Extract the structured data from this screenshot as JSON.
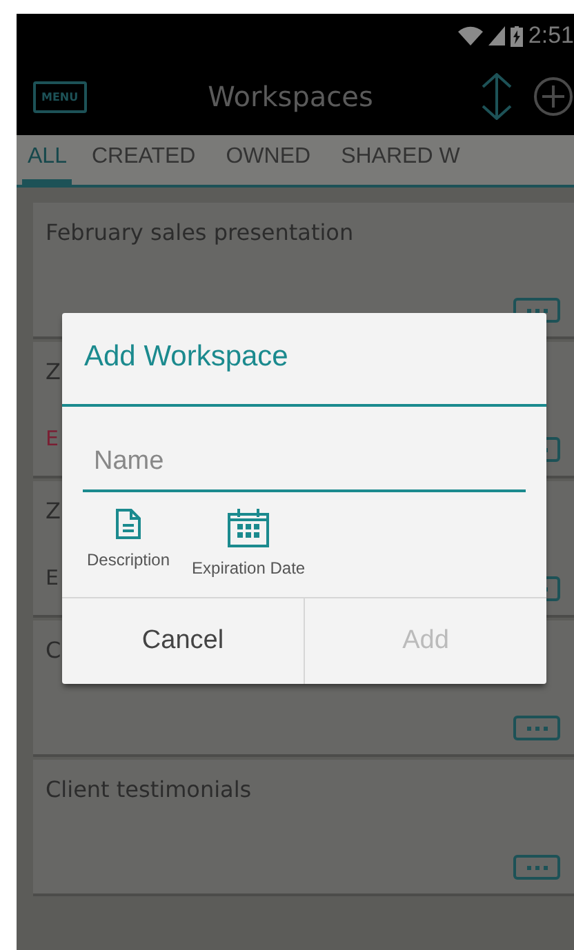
{
  "status_bar": {
    "time": "2:51"
  },
  "app_bar": {
    "menu_button": "MENU",
    "title": "Workspaces"
  },
  "tabs": [
    {
      "label": "ALL",
      "selected": true
    },
    {
      "label": "CREATED",
      "selected": false
    },
    {
      "label": "OWNED",
      "selected": false
    },
    {
      "label": "SHARED W",
      "selected": false
    }
  ],
  "workspaces": [
    {
      "title": "February sales presentation"
    },
    {
      "title": "Z",
      "subtitle": {
        "text": "E",
        "color": "#7a1f33"
      }
    },
    {
      "title": "Z",
      "subtitle": {
        "text": "E",
        "color": "#2c2c2c"
      }
    },
    {
      "title": "C"
    },
    {
      "title": "Client testimonials"
    }
  ],
  "dialog": {
    "title": "Add Workspace",
    "name_field": {
      "placeholder": "Name"
    },
    "actions": [
      {
        "kind": "document",
        "label": "Description"
      },
      {
        "kind": "calendar",
        "label": "Expiration Date"
      }
    ],
    "buttons": [
      {
        "label": "Cancel",
        "disabled": false
      },
      {
        "label": "Add",
        "disabled": true
      }
    ]
  }
}
